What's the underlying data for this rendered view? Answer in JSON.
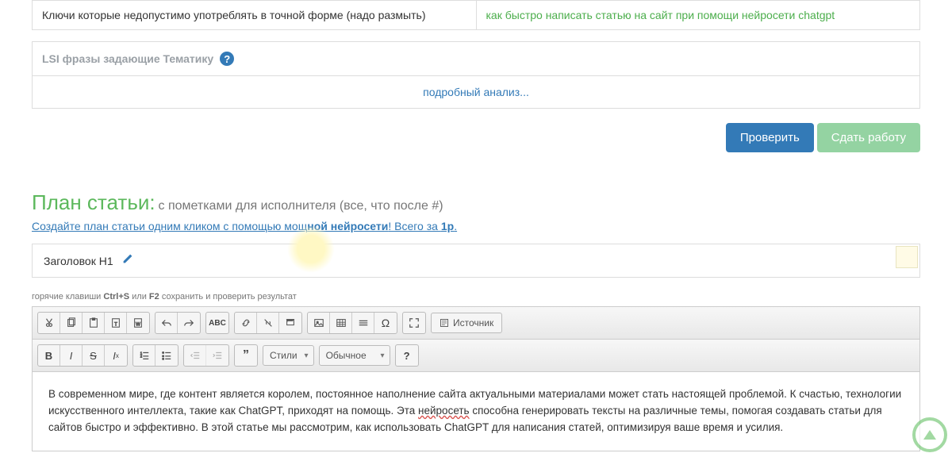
{
  "keys_table": {
    "left": "Ключи которые недопустимо употреблять в точной форме (надо размыть)",
    "right": "как быстро написать статью на сайт при помощи нейросети chatgpt"
  },
  "lsi": {
    "header": "LSI фразы задающие Тематику",
    "body": "подробный анализ..."
  },
  "buttons": {
    "check": "Проверить",
    "submit": "Сдать работу"
  },
  "plan": {
    "title": "План статьи:",
    "subtitle": "с пометками для исполнителя (все, что после #)",
    "link_pre": "Создайте план статьи одним кликом с помощью мощ",
    "link_mid": "ной нейросети",
    "link_post": "! Всего за ",
    "link_price": "1р",
    "link_dot": "."
  },
  "h1": {
    "label": "Заголовок H1"
  },
  "hotkeys": {
    "pre": "горячие клавиши ",
    "k1": "Ctrl+S",
    "mid": " или ",
    "k2": "F2",
    "post": " сохранить и проверить результат"
  },
  "toolbar": {
    "styles": "Стили",
    "format": "Обычное",
    "source": "Источник"
  },
  "content": {
    "p1a": "В современном мире, где контент является королем, постоянное наполнение сайта актуальными материалами может стать настоящей проблемой. К счастью, технологии искусственного интеллекта, такие как ChatGPT, приходят на помощь. Эта ",
    "p1err": "нейросеть",
    "p1b": " способна генерировать тексты на различные темы, помогая создавать статьи для сайтов быстро и эффективно. В этой статье мы рассмотрим, как использовать ChatGPT для написания статей, оптимизируя ваше время и усилия."
  }
}
